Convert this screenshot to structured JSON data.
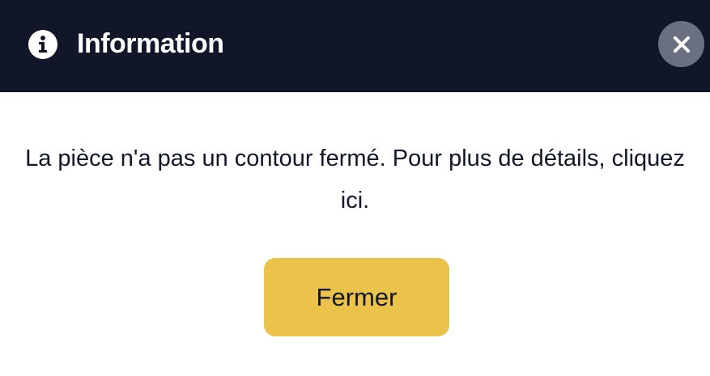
{
  "dialog": {
    "title": "Information",
    "icon": "info-circle-icon",
    "close_icon": "close-icon",
    "message": "La pièce n'a pas un contour fermé. Pour plus de détails, cliquez ici.",
    "button_label": "Fermer"
  },
  "colors": {
    "header_background": "#111729",
    "close_button_background": "#6b7080",
    "primary_button_background": "#ebc34a",
    "text": "#111729"
  }
}
